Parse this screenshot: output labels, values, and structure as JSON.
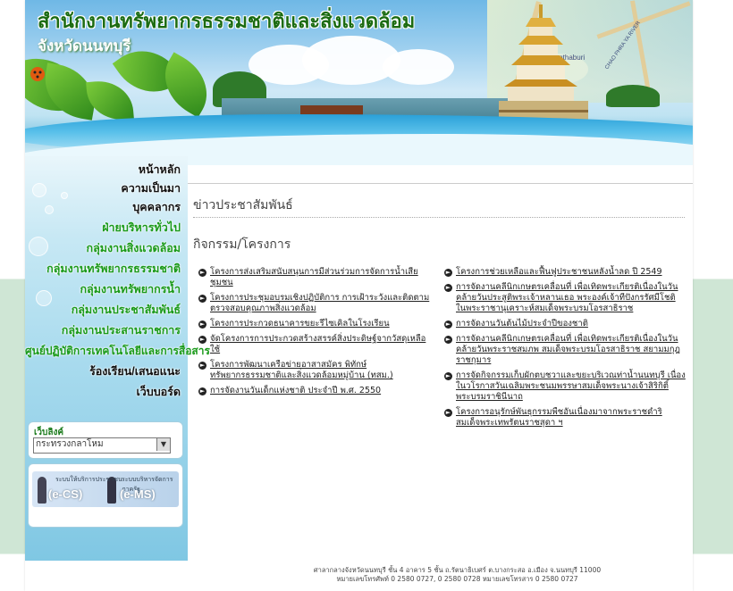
{
  "header": {
    "title": "สำนักงานทรัพยากรธรรมชาติและสิ่งแวดล้อม",
    "subtitle": "จังหวัดนนทบุรี",
    "map_label_1": "Nonthaburi",
    "map_label_2": "CHAO PHRA YA RIVER"
  },
  "sidebar": {
    "items": [
      {
        "label": "หน้าหลัก",
        "style": "dark"
      },
      {
        "label": "ความเป็นมา",
        "style": "dark"
      },
      {
        "label": "บุคคลากร",
        "style": "dark"
      },
      {
        "label": "ฝ่ายบริหารทั่วไป",
        "style": "green"
      },
      {
        "label": "กลุ่มงานสิ่งแวดล้อม",
        "style": "green"
      },
      {
        "label": "กลุ่มงานทรัพยากรธรรมชาติ",
        "style": "green"
      },
      {
        "label": "กลุ่มงานทรัพยากรน้ำ",
        "style": "green"
      },
      {
        "label": "กลุ่มงานประชาสัมพันธ์",
        "style": "green"
      },
      {
        "label": "กลุ่มงานประสานราชการ",
        "style": "green"
      },
      {
        "label": "ศูนย์ปฏิบัติการเทคโนโลยีและการสื่อสาร",
        "style": "green"
      },
      {
        "label": "ร้องเรียน/เสนอแนะ",
        "style": "dark"
      },
      {
        "label": "เว็บบอร์ด",
        "style": "dark"
      }
    ],
    "links": {
      "title": "เว็บลิงค์",
      "selected": "กระทรวงกลาโหม"
    },
    "services": {
      "left_label": "(e-CS)",
      "right_label": "(e-MS)",
      "left_small": "ระบบให้บริการประชาชน",
      "right_small": "ระบบบริหารจัดการภาครัฐ"
    }
  },
  "main": {
    "section_title": "ข่าวประชาสัมพันธ์",
    "subsection_title": "กิจกรรม/โครงการ",
    "left_items": [
      "โครงการส่งเสริมสนับสนุนการมีส่วนร่วมการจัดการน้ำเสียชุมชน",
      "โครงการประชุมอบรมเชิงปฏิบัติการ การเฝ้าระวังและติดตามตรวจสอบคุณภาพสิ่งแวดล้อม",
      "โครงการประกวดธนาคารขยะรีไซเคิลในโรงเรียน",
      "จัดโครงการการประกวดสร้างสรรค์สิ่งประดิษฐ์จากวัสดุเหลือใช้",
      "โครงการพัฒนาเครือข่ายอาสาสมัคร พิทักษ์ทรัพยากรธรรมชาติและสิ่งแวดล้อมหมู่บ้าน (ทสม.)",
      "การจัดงานวันเด็กแห่งชาติ ประจำปี พ.ศ. 2550"
    ],
    "right_items": [
      "โครงการช่วยเหลือและฟื้นฟูประชาชนหลังน้ำลด ปี 2549",
      "การจัดงานคลีนิกเกษตรเคลื่อนที่ เพื่อเทิดพระเกียรติเนื่องในวันคล้ายวันประสูติพระเจ้าหลานเธอ พระองค์เจ้าทีปังกรรัศมีโชติ ในพระราชานุเคราะห์สมเด็จพระบรมโอรสาธิราช",
      "การจัดงานวันต้นไม้ประจำปีของชาติ",
      "การจัดงานคลีนิกเกษตรเคลื่อนที่ เพื่อเทิดพระเกียรติเนื่องในวันคล้ายวันพระราชสมภพ สมเด็จพระบรมโอรสาธิราช สยามมกุฎราชกุมาร",
      "การจัดกิจกรรมเก็บผักตบชวาและขยะบริเวณท่าน้ำนนทบุรี เนื่องในวโรกาสวันเฉลิมพระชนมพรรษาสมเด็จพระนางเจ้าสิริกิติ์พระบรมราชินีนาถ",
      "โครงการอนุรักษ์พันธุกรรมพืชอันเนื่องมาจากพระราชดำริสมเด็จพระเทพรัตนราชสุดา ฯ"
    ]
  },
  "footer": {
    "line1": "ศาลากลางจังหวัดนนทบุรี ชั้น 4 อาคาร 5 ชั้น ถ.รัตนาธิเบศร์ ต.บางกระสอ อ.เมือง จ.นนทบุรี 11000",
    "line2": "หมายเลขโทรศัพท์ 0 2580 0727, 0 2580 0728 หมายเลขโทรสาร 0 2580 0727"
  },
  "colors": {
    "title_green": "#1b6b12",
    "nav_green": "#1a9a1a",
    "background_band": "#cfe6d5"
  }
}
